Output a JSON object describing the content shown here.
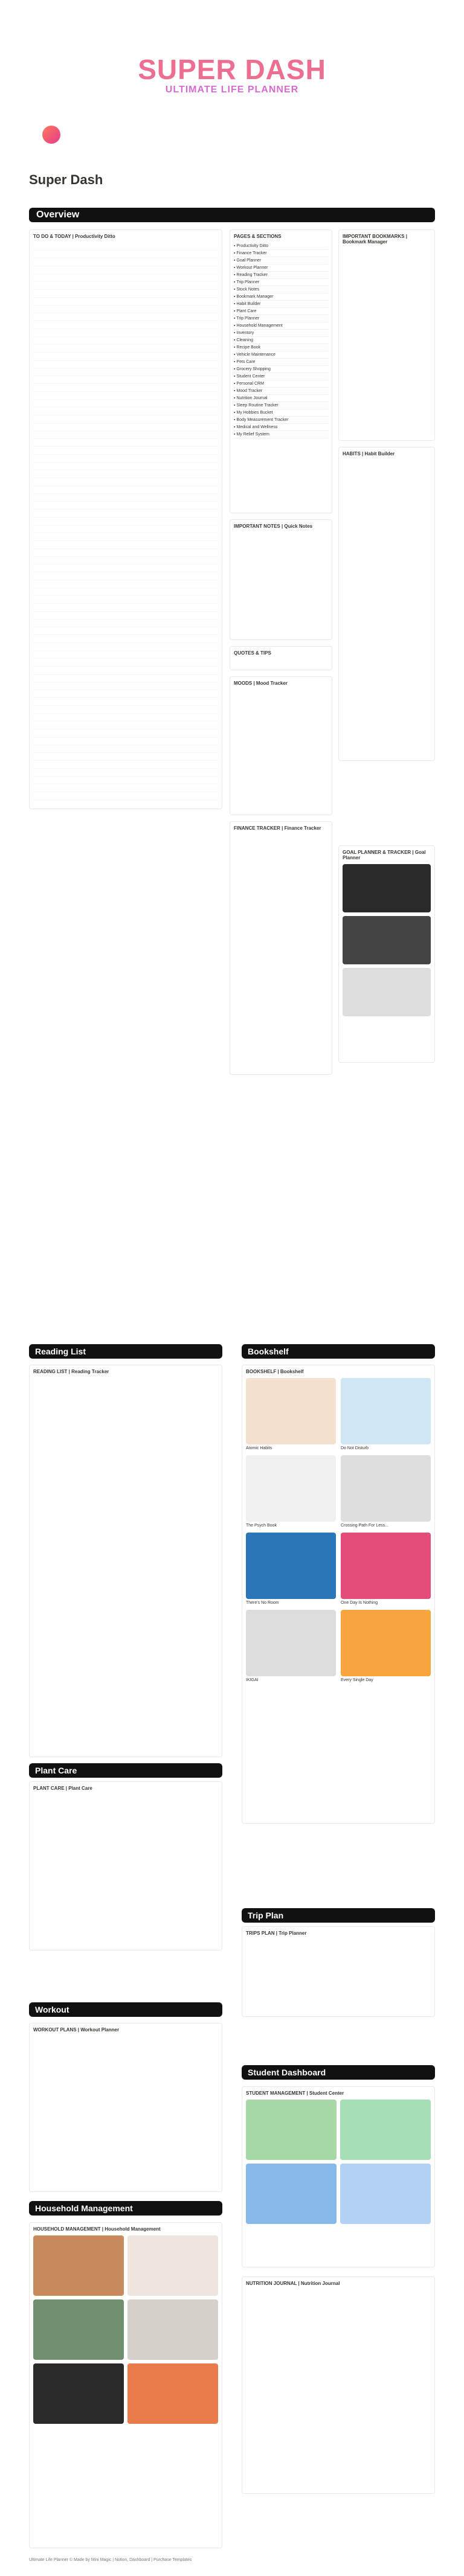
{
  "hero": {
    "title": "SUPER DASH",
    "subtitle": "ULTIMATE LIFE PLANNER",
    "page_title": "Super Dash"
  },
  "banners": {
    "overview": "Overview",
    "reading_list": "Reading List",
    "bookshelf": "Bookshelf",
    "plant_care": "Plant Care",
    "trip_plan": "Trip Plan",
    "workout": "Workout",
    "student_dashboard": "Student Dashboard",
    "household_management": "Household Management"
  },
  "overview": {
    "todo_title": "TO DO & TODAY | Productivity Ditto",
    "pages_title": "PAGES & SECTIONS",
    "pages": [
      "Productivity Ditto",
      "Finance Tracker",
      "Goal Planner",
      "Workout Planner",
      "Reading Tracker",
      "Trip Planner",
      "Stock Notes",
      "Bookmark Manager",
      "Habit Builder",
      "Plant Care",
      "Trip Planner",
      "Household Management",
      "Inventory",
      "Cleaning",
      "Recipe Book",
      "Vehicle Maintenance",
      "Pets Care",
      "Grocery Shopping",
      "Student Center",
      "Personal CRM",
      "Mood Tracker",
      "Nutrition Journal",
      "Sleep Routine Tracker",
      "My Hobbies Bucket",
      "Body Measurement Tracker",
      "Medical and Wellness",
      "My Relief System"
    ],
    "bookmark_title": "IMPORTANT BOOKMARKS | Bookmark Manager",
    "habits_title": "HABITS | Habit Builder",
    "notes_title": "IMPORTANT NOTES | Quick Notes",
    "quotes_title": "QUOTES & TIPS",
    "blood_title": "MOODS | Mood Tracker",
    "finance_title": "FINANCE TRACKER | Finance Tracker",
    "goal_title": "GOAL PLANNER & TRACKER | Goal Planner"
  },
  "reading": {
    "card_title": "READING LIST | Reading Tracker",
    "bookshelf_title": "BOOKSHELF | Bookshelf",
    "books": [
      "Atomic Habits",
      "Do Not Disturb",
      "The Psych Book",
      "Crossing Path For Less...",
      "There's No Room",
      "One Day Is Nothing",
      "IKIGAI",
      "Every Single Day"
    ]
  },
  "plant": {
    "card_title": "PLANT CARE | Plant Care"
  },
  "trip": {
    "card_title": "TRIPS PLAN | Trip Planner"
  },
  "workout": {
    "card_title": "WORKOUT PLANS | Workout Planner"
  },
  "student": {
    "card_title": "STUDENT MANAGEMENT | Student Center"
  },
  "household": {
    "card_title": "HOUSEHOLD MANAGEMENT | Household Management"
  },
  "nutrition": {
    "card_title": "NUTRITION JOURNAL | Nutrition Journal"
  },
  "footer": "Ultimate Life Planner © Made by Mini Magic | Notion, Dashboard | Purchase Templates"
}
